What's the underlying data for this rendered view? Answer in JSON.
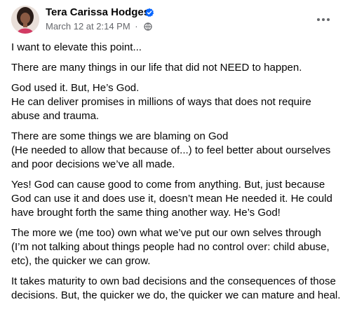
{
  "author": {
    "name": "Tera Carissa Hodges",
    "verified": true,
    "timestamp": "March 12 at 2:14 PM",
    "separator": "·",
    "audience_icon": "globe-icon",
    "avatar_icon": "profile-photo"
  },
  "more_menu_icon": "more-options-icon",
  "post": {
    "paragraphs": [
      [
        "I want to elevate this point..."
      ],
      [
        "There are many things in our life that did not NEED to happen."
      ],
      [
        "God used it. But, He’s God.",
        "He can deliver promises in millions of ways that does not require abuse and trauma."
      ],
      [
        "There are some things we are blaming on God",
        "(He needed to allow that because of...) to feel better about ourselves and poor decisions we’ve all made."
      ],
      [
        "Yes! God can cause good to come from anything. But, just because God can use it and does use it, doesn’t mean He needed it. He could have brought forth the same thing another way. He’s God!"
      ],
      [
        "The more we (me too) own what we’ve put our own selves through",
        "(I’m not talking about things people had no control over: child abuse, etc), the quicker we can grow."
      ],
      [
        "It takes maturity to own bad decisions and the consequences of those decisions. But, the quicker we do, the quicker we can mature and heal."
      ]
    ]
  },
  "colors": {
    "primary_text": "#050505",
    "secondary_text": "#65676b",
    "verified_blue": "#0866ff",
    "background": "#ffffff"
  }
}
